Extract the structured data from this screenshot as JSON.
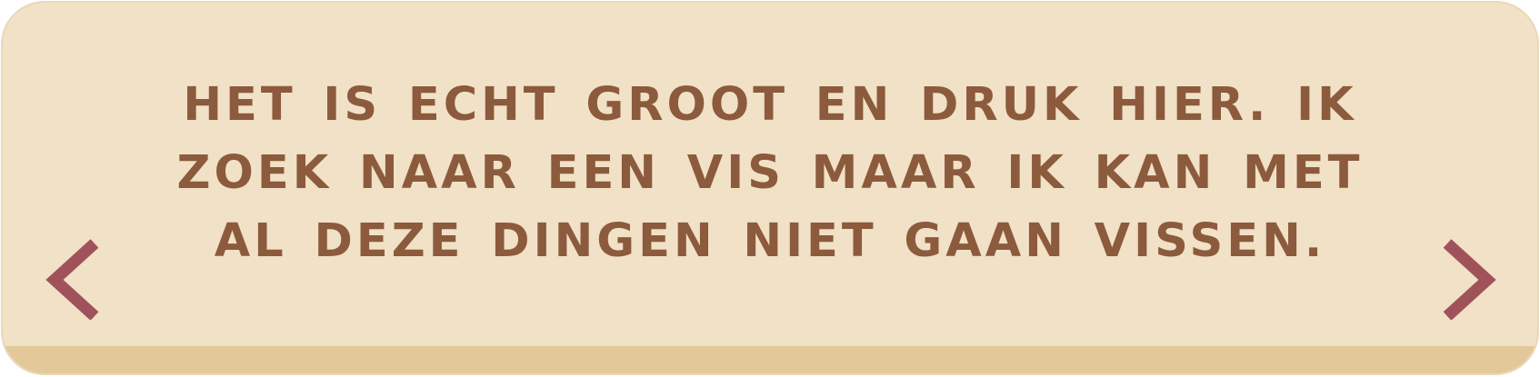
{
  "dialog": {
    "text": "Het is echt groot en druk hier. Ik zoek naar een vis maar ik kan met al deze dingen niet gaan vissen."
  },
  "navigation": {
    "previous_icon": "chevron-left-icon",
    "next_icon": "chevron-right-icon",
    "arrow_color": "#a0525a"
  },
  "theme": {
    "panel_color": "#f1e1c6",
    "panel_bottom_color": "#e3c899",
    "text_color": "#8c5a3c"
  }
}
